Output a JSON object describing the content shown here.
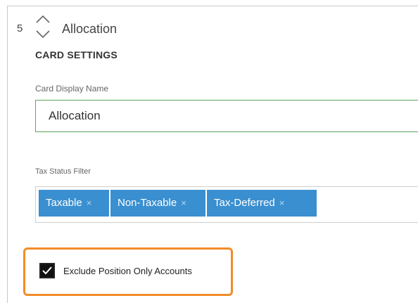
{
  "card": {
    "order_number": "5",
    "title": "Allocation"
  },
  "settings": {
    "heading": "CARD SETTINGS",
    "display_name_label": "Card Display Name",
    "display_name_value": "Allocation",
    "tax_filter_label": "Tax Status Filter",
    "tax_tags": [
      {
        "label": "Taxable",
        "remove": "×"
      },
      {
        "label": "Non-Taxable",
        "remove": "×"
      },
      {
        "label": "Tax-Deferred",
        "remove": "×"
      }
    ],
    "exclude_checkbox": {
      "label": "Exclude Position Only Accounts",
      "checked": true
    }
  },
  "colors": {
    "tag_bg": "#3a8fd0",
    "input_focus_border": "#5aa35a",
    "highlight_border": "#f28c28"
  },
  "icons": {
    "reorder": "chevron-up-down-icon",
    "checkmark": "checkmark-icon"
  }
}
